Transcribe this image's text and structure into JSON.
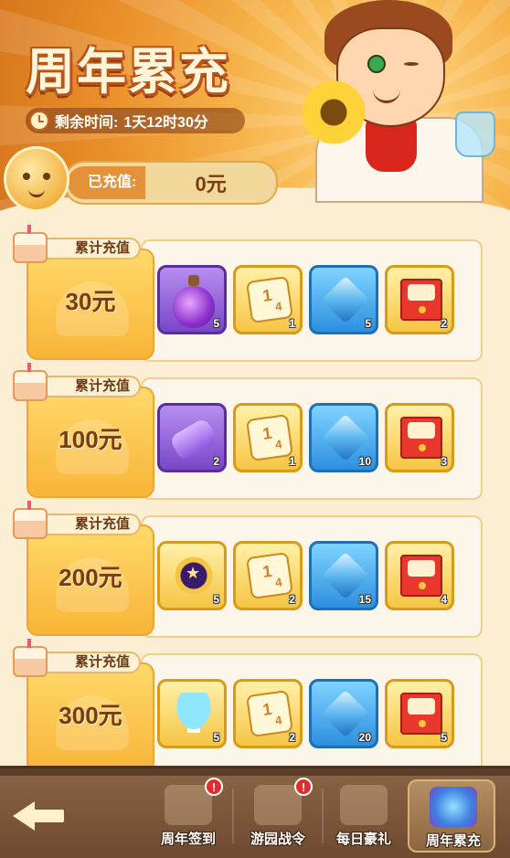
{
  "header": {
    "title": "周年累充",
    "timer_label": "剩余时间:",
    "timer_value": "1天12时30分",
    "recharged_label": "已充值:",
    "recharged_value": "0元"
  },
  "tiers": [
    {
      "tag": "累计充值",
      "amount": "30元",
      "items": [
        {
          "icon": "potion-icon",
          "count": "5"
        },
        {
          "icon": "dice-icon",
          "count": "1"
        },
        {
          "icon": "crystal-icon",
          "count": "5"
        },
        {
          "icon": "envelope-icon",
          "count": "2"
        }
      ]
    },
    {
      "tag": "累计充值",
      "amount": "100元",
      "items": [
        {
          "icon": "tube-icon",
          "count": "2"
        },
        {
          "icon": "dice-icon",
          "count": "1"
        },
        {
          "icon": "crystal-icon",
          "count": "10"
        },
        {
          "icon": "envelope-icon",
          "count": "3"
        }
      ]
    },
    {
      "tag": "累计充值",
      "amount": "200元",
      "items": [
        {
          "icon": "star-orb-icon",
          "count": "5"
        },
        {
          "icon": "dice-icon",
          "count": "2"
        },
        {
          "icon": "crystal-icon",
          "count": "15"
        },
        {
          "icon": "envelope-icon",
          "count": "4"
        }
      ]
    },
    {
      "tag": "累计充值",
      "amount": "300元",
      "items": [
        {
          "icon": "mushroom-icon",
          "count": "5"
        },
        {
          "icon": "dice-icon",
          "count": "2"
        },
        {
          "icon": "crystal-icon",
          "count": "20"
        },
        {
          "icon": "envelope-icon",
          "count": "5"
        }
      ]
    }
  ],
  "nav": {
    "back_icon": "back-arrow-icon",
    "tabs": [
      {
        "label": "周年签到",
        "badge": "!"
      },
      {
        "label": "游园战令",
        "badge": "!"
      },
      {
        "label": "每日豪礼",
        "badge": ""
      },
      {
        "label": "周年累充",
        "badge": ""
      }
    ]
  },
  "colors": {
    "accent": "#f8b437",
    "background": "#fbeed3",
    "nav_bar": "#7a5538"
  }
}
